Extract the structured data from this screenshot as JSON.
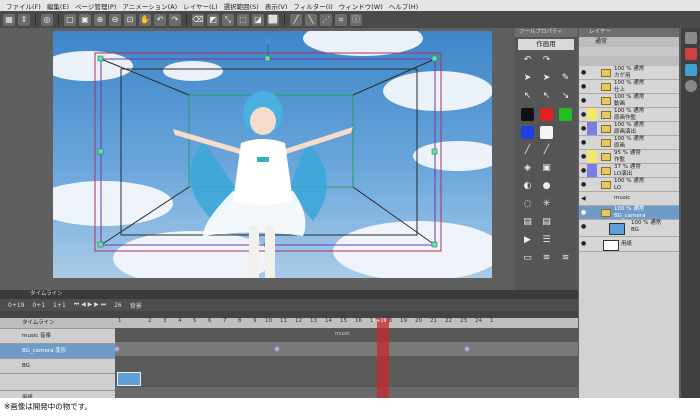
{
  "menu": {
    "items": [
      "ファイル(F)",
      "編集(E)",
      "ページ管理(P)",
      "アニメーション(A)",
      "レイヤー(L)",
      "選択範囲(S)",
      "表示(V)",
      "フィルター(I)",
      "ウィンドウ(W)",
      "ヘルプ(H)"
    ]
  },
  "tool_palette": {
    "tab_label": "ツールプロパティ",
    "title": "作画用"
  },
  "layer_panel": {
    "tab_label": "レイヤー",
    "blend_mode": "通常",
    "layers": [
      {
        "name": "100 % 通常\nカゲ用",
        "highlight": ""
      },
      {
        "name": "100 % 通常\n仕上",
        "highlight": ""
      },
      {
        "name": "100 % 通常\n動画",
        "highlight": ""
      },
      {
        "name": "100 % 通常\n原画作監",
        "highlight": "#f2e86a"
      },
      {
        "name": "100 % 通常\n原画演出",
        "highlight": "#7b7be6"
      },
      {
        "name": "100 % 通常\n原画",
        "highlight": ""
      },
      {
        "name": "95 % 通常\n作監",
        "highlight": "#f2e86a"
      },
      {
        "name": "37 % 通常\nLO演出",
        "highlight": "#7b7be6"
      },
      {
        "name": "100 % 通常\nLO",
        "highlight": ""
      }
    ],
    "music_layer": "music",
    "selected_layer": "100 % 通常\nBG_camera",
    "bg_layer": "100 % 通常\nBG",
    "paper_layer": "用紙"
  },
  "timeline": {
    "tab_label": "タイムライン",
    "controls": [
      "0+19",
      "0+1",
      "1+1",
      "26",
      "背景"
    ],
    "title": "タイムライン",
    "tracks": [
      "music 音楽",
      "BG_camera 変形",
      "BG",
      "",
      "用紙"
    ],
    "frame_labels": [
      "1",
      "2",
      "3",
      "4",
      "5",
      "6",
      "7",
      "8",
      "9",
      "10",
      "11",
      "12",
      "13",
      "14",
      "15",
      "16",
      "17",
      "18",
      "19",
      "20",
      "21",
      "22",
      "23",
      "24",
      "1"
    ],
    "playhead_label": "0+19",
    "music_label": "music"
  },
  "footer_note": "※画像は開発中の物です。",
  "colors": {
    "accent": "#6f9bc9",
    "playhead": "#c82828",
    "sky": "#3e86c8"
  }
}
